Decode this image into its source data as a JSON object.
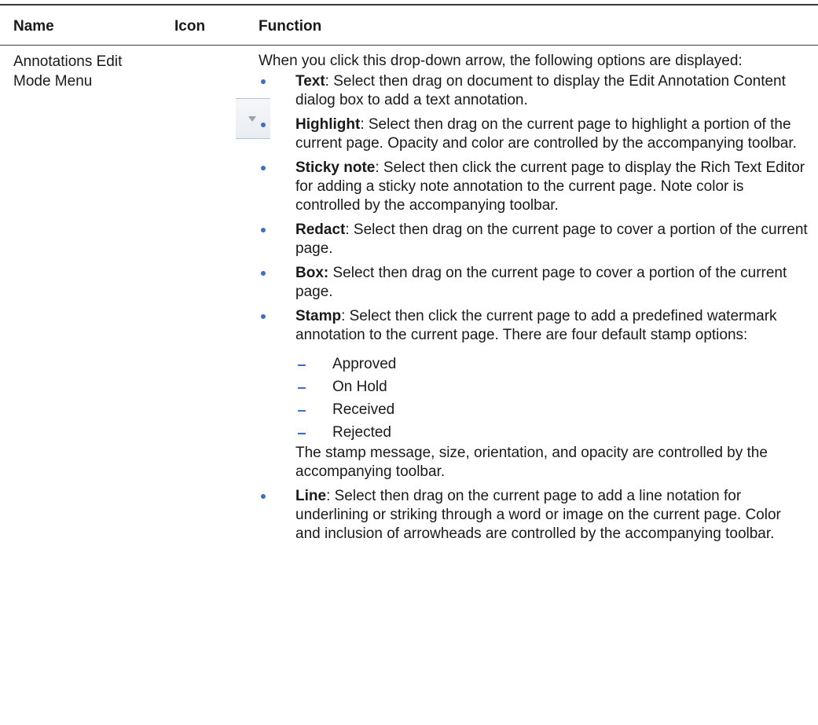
{
  "table": {
    "headers": {
      "name": "Name",
      "icon": "Icon",
      "function": "Function"
    },
    "row": {
      "name": "Annotations Edit Mode Menu",
      "icon": "dropdown-arrow-icon",
      "intro": "When you click this drop-down arrow, the following options are displayed:",
      "items": [
        {
          "term": "Text",
          "text": ": Select then drag on document to display the Edit Annotation Content dialog box to add a text annotation."
        },
        {
          "term": "Highlight",
          "text": ": Select then drag on the current page to highlight a portion of the current page. Opacity and color are controlled by the accompanying toolbar."
        },
        {
          "term": "Sticky note",
          "text": ": Select then click the current page to display the Rich Text Editor for adding a sticky note annotation to the current page. Note color is controlled by the accompanying toolbar."
        },
        {
          "term": "Redact",
          "text": ": Select then drag on the current page to cover a portion of the current page."
        },
        {
          "term": "Box:",
          "text": " Select then drag on the current page to cover a portion of the current page."
        },
        {
          "term": "Stamp",
          "text": ": Select then click the current page to add a predefined watermark annotation to the current page. There are four default stamp options:"
        },
        {
          "term": "Line",
          "text": ": Select then drag on the current page to add a line notation for underlining or striking through a word or image on the current page. Color and inclusion of arrowheads are controlled by the accompanying toolbar."
        }
      ],
      "stamp_options": [
        "Approved",
        "On Hold",
        "Received",
        "Rejected"
      ],
      "stamp_note": "The stamp message, size, orientation, and opacity are controlled by the accompanying toolbar."
    }
  },
  "colors": {
    "bullet": "#3d6fbd",
    "rule": "#3a3a3a"
  }
}
